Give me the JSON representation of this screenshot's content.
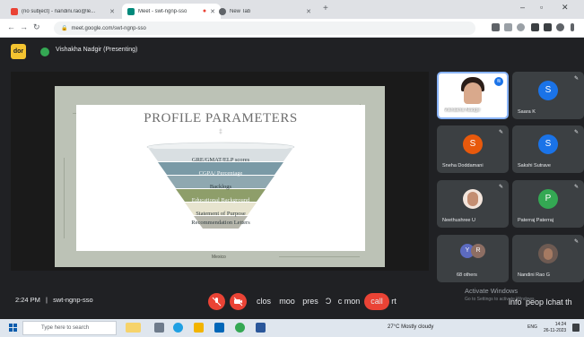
{
  "browser": {
    "tabs": [
      {
        "title": "(no subject) - nandini.rao@le...",
        "active": false
      },
      {
        "title": "Meet - swt-ngnp-sso",
        "active": true
      },
      {
        "title": "New Tab",
        "active": false
      }
    ],
    "url": "meet.google.com/swt-ngnp-sso"
  },
  "meet": {
    "presenter_badge": "dor",
    "presenting_label": "Vishakha Nadgir (Presenting)",
    "time": "2:24 PM",
    "separator": "|",
    "meeting_code": "swt-ngnp-sso"
  },
  "slide": {
    "title": "PROFILE PARAMETERS",
    "subtitle": "‡",
    "funnel": [
      {
        "label": "GRE/GMAT/ELP scores",
        "color": "#d9dfe2"
      },
      {
        "label": "CGPA/ Percentage",
        "color": "#7a9aa6"
      },
      {
        "label": "Backlogs",
        "color": "#8fa8b0"
      },
      {
        "label": "Educational Background",
        "color": "#8e9e6a"
      },
      {
        "label": "Statement of Purpose",
        "color": "#e7e4cf"
      },
      {
        "label": "Recommendation Letters",
        "color": "#b7b7ac"
      }
    ],
    "map_label": "Mexico"
  },
  "participants": [
    {
      "name": "Vishakha Nadgir",
      "type": "photo",
      "speaking": true
    },
    {
      "name": "Saara K",
      "initial": "S",
      "color": "#1a73e8"
    },
    {
      "name": "Sneha Doddamani",
      "initial": "S",
      "color": "#e8590c"
    },
    {
      "name": "Sakshi Sutrave",
      "initial": "S",
      "color": "#1a73e8"
    },
    {
      "name": "Neethushree U",
      "type": "photo"
    },
    {
      "name": "Paterraj Paterraj",
      "initial": "P",
      "color": "#34a853"
    },
    {
      "name": "68 others",
      "type": "others",
      "initials": [
        "Y",
        "R"
      ]
    },
    {
      "name": "Nandini Rao G",
      "type": "photo"
    }
  ],
  "controls": {
    "mic_label": "",
    "cam_label": "",
    "close_cc": "clos",
    "more_reactions": "moo",
    "present": "pres",
    "raise_hand": "Ɔ",
    "more": "c mon",
    "end_call": "call",
    "end_call_suffix": "rt",
    "info": "info",
    "people": "peop",
    "chat": "lchat",
    "activities": "th"
  },
  "watermark": {
    "title": "Activate Windows",
    "subtitle": "Go to Settings to activate Windows."
  },
  "taskbar": {
    "search_placeholder": "Type here to search",
    "weather": "27°C  Mostly cloudy",
    "time": "14:24",
    "date": "26-11-2023",
    "lang": "ENG"
  }
}
